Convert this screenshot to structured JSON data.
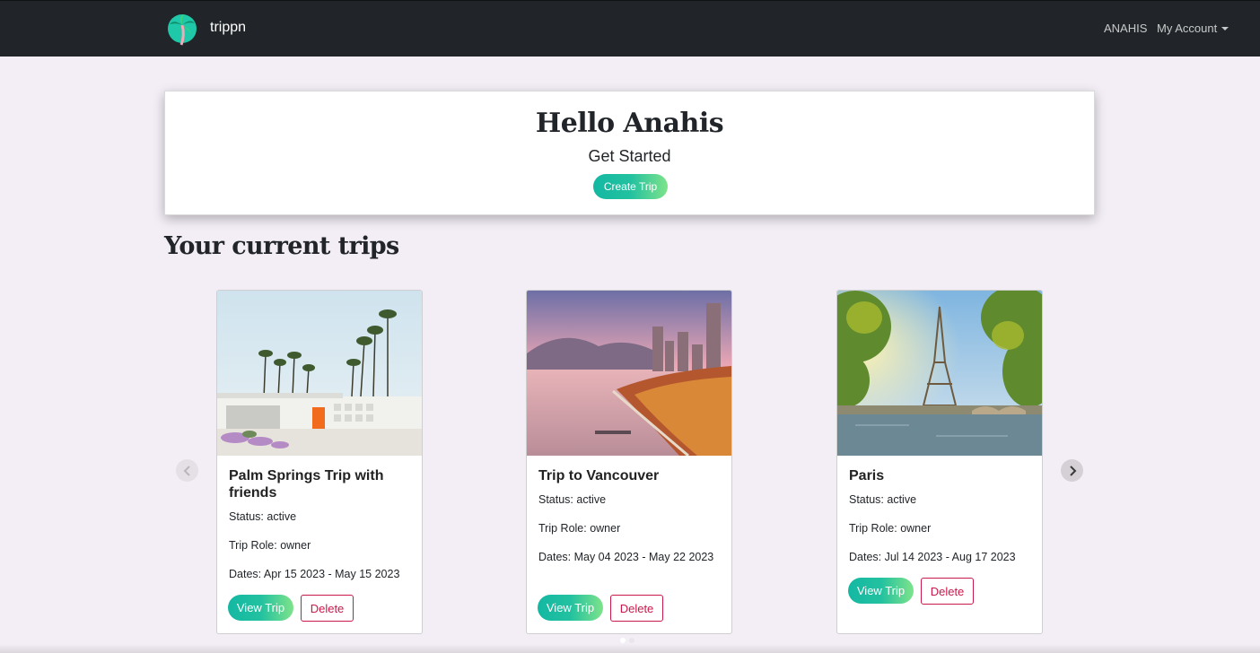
{
  "navbar": {
    "brand": "trippn",
    "user": "ANAHIS",
    "account": "My Account"
  },
  "hero": {
    "greeting": "Hello Anahis",
    "subtitle": "Get Started",
    "create_button": "Create Trip"
  },
  "section_title": "Your current trips",
  "trips": [
    {
      "title": "Palm Springs Trip with friends",
      "status": "Status: active",
      "role": "Trip Role: owner",
      "dates": "Dates: Apr 15 2023 - May 15 2023",
      "view_label": "View Trip",
      "delete_label": "Delete"
    },
    {
      "title": "Trip to Vancouver",
      "status": "Status: active",
      "role": "Trip Role: owner",
      "dates": "Dates: May 04 2023 - May 22 2023",
      "view_label": "View Trip",
      "delete_label": "Delete"
    },
    {
      "title": "Paris",
      "status": "Status: active",
      "role": "Trip Role: owner",
      "dates": "Dates: Jul 14 2023 - Aug 17 2023",
      "view_label": "View Trip",
      "delete_label": "Delete"
    }
  ],
  "carousel": {
    "prev_icon": "chevron-left-icon",
    "next_icon": "chevron-right-icon",
    "active_page": 1,
    "page_count": 2
  },
  "colors": {
    "navbar_bg": "#212529",
    "page_bg": "#f3eef6",
    "accent_start": "#14b8a2",
    "accent_end": "#7ee38a",
    "danger": "#c9184a"
  }
}
